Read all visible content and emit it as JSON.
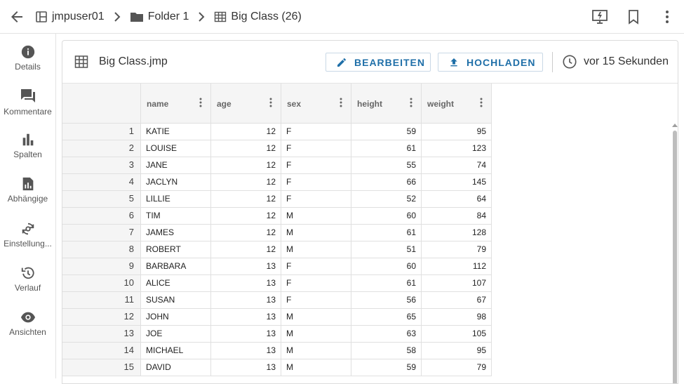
{
  "breadcrumb": {
    "items": [
      {
        "label": "jmpuser01",
        "icon": "workspace-icon"
      },
      {
        "label": "Folder 1",
        "icon": "folder-icon"
      },
      {
        "label": "Big Class (26)",
        "icon": "table-icon"
      }
    ]
  },
  "toolbar": {
    "right_icons": [
      "presentation-icon",
      "bookmark-icon",
      "more-vert-icon"
    ]
  },
  "sidebar": {
    "items": [
      {
        "label": "Details",
        "icon": "info-icon"
      },
      {
        "label": "Kommentare",
        "icon": "comments-icon"
      },
      {
        "label": "Spalten",
        "icon": "bar-chart-icon"
      },
      {
        "label": "Abhängige",
        "icon": "dependents-icon"
      },
      {
        "label": "Einstellung...",
        "icon": "settings-sync-icon"
      },
      {
        "label": "Verlauf",
        "icon": "history-icon"
      },
      {
        "label": "Ansichten",
        "icon": "eye-icon"
      }
    ]
  },
  "panel": {
    "title": "Big Class.jmp",
    "edit_label": "BEARBEITEN",
    "upload_label": "HOCHLADEN",
    "timestamp": "vor 15 Sekunden"
  },
  "table": {
    "columns": [
      "name",
      "age",
      "sex",
      "height",
      "weight"
    ],
    "rows": [
      {
        "n": "1",
        "name": "KATIE",
        "age": "12",
        "sex": "F",
        "height": "59",
        "weight": "95"
      },
      {
        "n": "2",
        "name": "LOUISE",
        "age": "12",
        "sex": "F",
        "height": "61",
        "weight": "123"
      },
      {
        "n": "3",
        "name": "JANE",
        "age": "12",
        "sex": "F",
        "height": "55",
        "weight": "74"
      },
      {
        "n": "4",
        "name": "JACLYN",
        "age": "12",
        "sex": "F",
        "height": "66",
        "weight": "145"
      },
      {
        "n": "5",
        "name": "LILLIE",
        "age": "12",
        "sex": "F",
        "height": "52",
        "weight": "64"
      },
      {
        "n": "6",
        "name": "TIM",
        "age": "12",
        "sex": "M",
        "height": "60",
        "weight": "84"
      },
      {
        "n": "7",
        "name": "JAMES",
        "age": "12",
        "sex": "M",
        "height": "61",
        "weight": "128"
      },
      {
        "n": "8",
        "name": "ROBERT",
        "age": "12",
        "sex": "M",
        "height": "51",
        "weight": "79"
      },
      {
        "n": "9",
        "name": "BARBARA",
        "age": "13",
        "sex": "F",
        "height": "60",
        "weight": "112"
      },
      {
        "n": "10",
        "name": "ALICE",
        "age": "13",
        "sex": "F",
        "height": "61",
        "weight": "107"
      },
      {
        "n": "11",
        "name": "SUSAN",
        "age": "13",
        "sex": "F",
        "height": "56",
        "weight": "67"
      },
      {
        "n": "12",
        "name": "JOHN",
        "age": "13",
        "sex": "M",
        "height": "65",
        "weight": "98"
      },
      {
        "n": "13",
        "name": "JOE",
        "age": "13",
        "sex": "M",
        "height": "63",
        "weight": "105"
      },
      {
        "n": "14",
        "name": "MICHAEL",
        "age": "13",
        "sex": "M",
        "height": "58",
        "weight": "95"
      },
      {
        "n": "15",
        "name": "DAVID",
        "age": "13",
        "sex": "M",
        "height": "59",
        "weight": "79"
      }
    ]
  },
  "colors": {
    "accent": "#1f6fa8",
    "header_bg": "#f5f5f5",
    "border": "#e0e0e0"
  }
}
